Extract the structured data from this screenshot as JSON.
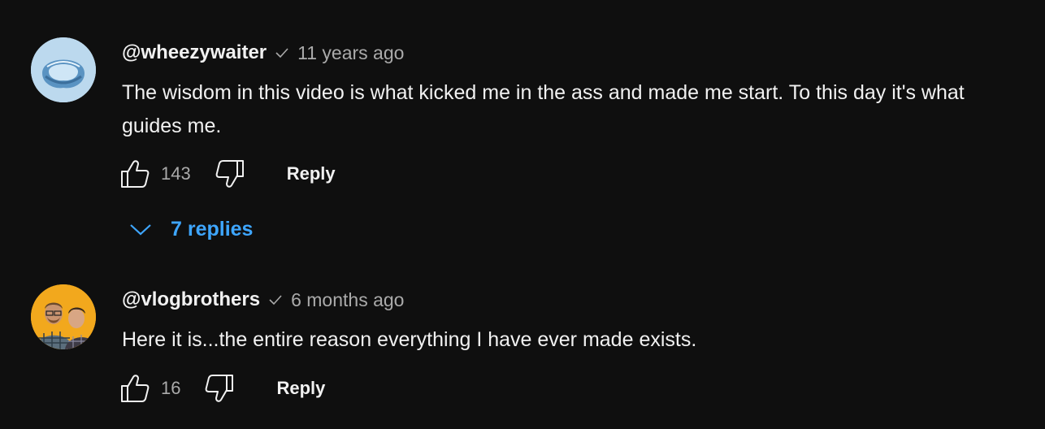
{
  "comments": [
    {
      "author": "@wheezywaiter",
      "time": "11 years ago",
      "text": "The wisdom in this video is what kicked me in the ass and made me start. To this day it's what guides me.",
      "likes": "143",
      "reply_label": "Reply",
      "replies_label": "7 replies"
    },
    {
      "author": "@vlogbrothers",
      "time": "6 months ago",
      "text": "Here it is...the entire reason everything I have ever made exists.",
      "likes": "16",
      "reply_label": "Reply"
    }
  ],
  "colors": {
    "background": "#0f0f0f",
    "text": "#f1f1f1",
    "secondary": "#aaaaaa",
    "link": "#3ea6ff"
  },
  "icons": [
    "verified-check-icon",
    "thumbs-up-icon",
    "thumbs-down-icon",
    "chevron-down-icon"
  ]
}
